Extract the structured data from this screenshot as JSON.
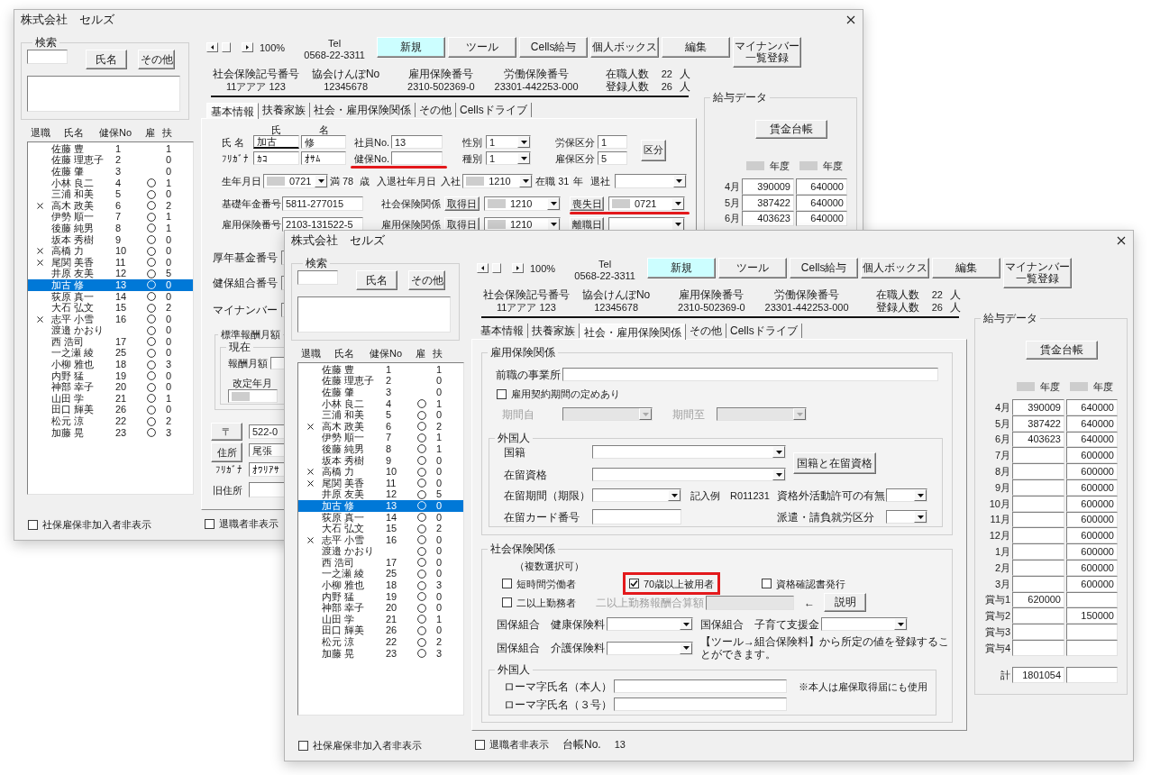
{
  "windows": [
    {
      "title": "株式会社　セルズ",
      "search": {
        "legend": "検索",
        "buttons": [
          "氏名",
          "その他"
        ]
      },
      "list": {
        "columns": [
          "退職",
          "氏名",
          "健保No",
          "雇",
          "扶"
        ],
        "rows": [
          {
            "retired": false,
            "name": "佐藤 豊",
            "no": "1",
            "employment_insured": false,
            "dependents": "1",
            "selected": false
          },
          {
            "retired": false,
            "name": "佐藤 理恵子",
            "no": "2",
            "employment_insured": false,
            "dependents": "0",
            "selected": false
          },
          {
            "retired": false,
            "name": "佐藤 肇",
            "no": "3",
            "employment_insured": false,
            "dependents": "0",
            "selected": false
          },
          {
            "retired": false,
            "name": "小林 良二",
            "no": "4",
            "employment_insured": true,
            "dependents": "1",
            "selected": false
          },
          {
            "retired": false,
            "name": "三浦 和美",
            "no": "5",
            "employment_insured": true,
            "dependents": "0",
            "selected": false
          },
          {
            "retired": true,
            "name": "高木 政美",
            "no": "6",
            "employment_insured": true,
            "dependents": "2",
            "selected": false
          },
          {
            "retired": false,
            "name": "伊勢 順一",
            "no": "7",
            "employment_insured": true,
            "dependents": "1",
            "selected": false
          },
          {
            "retired": false,
            "name": "後藤 純男",
            "no": "8",
            "employment_insured": true,
            "dependents": "1",
            "selected": false
          },
          {
            "retired": false,
            "name": "坂本 秀樹",
            "no": "9",
            "employment_insured": true,
            "dependents": "0",
            "selected": false
          },
          {
            "retired": true,
            "name": "高橋 力",
            "no": "10",
            "employment_insured": true,
            "dependents": "0",
            "selected": false
          },
          {
            "retired": true,
            "name": "尾関 美香",
            "no": "11",
            "employment_insured": true,
            "dependents": "0",
            "selected": false
          },
          {
            "retired": false,
            "name": "井原 友美",
            "no": "12",
            "employment_insured": true,
            "dependents": "5",
            "selected": false
          },
          {
            "retired": false,
            "name": "加古 修",
            "no": "13",
            "employment_insured": true,
            "dependents": "0",
            "selected": true
          },
          {
            "retired": false,
            "name": "荻原 真一",
            "no": "14",
            "employment_insured": true,
            "dependents": "0",
            "selected": false
          },
          {
            "retired": false,
            "name": "大石 弘文",
            "no": "15",
            "employment_insured": true,
            "dependents": "2",
            "selected": false
          },
          {
            "retired": true,
            "name": "志平 小雪",
            "no": "16",
            "employment_insured": true,
            "dependents": "0",
            "selected": false
          },
          {
            "retired": false,
            "name": "渡邉 かおり",
            "employment_insured": true,
            "dependents": "0",
            "selected": false
          },
          {
            "retired": false,
            "name": "西 浩司",
            "no": "17",
            "employment_insured": true,
            "dependents": "0",
            "selected": false
          },
          {
            "retired": false,
            "name": "一之瀬 綾",
            "no": "25",
            "employment_insured": true,
            "dependents": "0",
            "selected": false
          },
          {
            "retired": false,
            "name": "小柳 雅也",
            "no": "18",
            "employment_insured": true,
            "dependents": "3",
            "selected": false
          },
          {
            "retired": false,
            "name": "内野 猛",
            "no": "19",
            "employment_insured": true,
            "dependents": "0",
            "selected": false
          },
          {
            "retired": false,
            "name": "神部 幸子",
            "no": "20",
            "employment_insured": true,
            "dependents": "0",
            "selected": false
          },
          {
            "retired": false,
            "name": "山田 学",
            "no": "21",
            "employment_insured": true,
            "dependents": "1",
            "selected": false
          },
          {
            "retired": false,
            "name": "田口 輝美",
            "no": "26",
            "employment_insured": true,
            "dependents": "0",
            "selected": false
          },
          {
            "retired": false,
            "name": "松元 涼",
            "no": "22",
            "employment_insured": true,
            "dependents": "2",
            "selected": false
          },
          {
            "retired": false,
            "name": "加藤 晃",
            "no": "23",
            "employment_insured": true,
            "dependents": "3",
            "selected": false
          }
        ]
      },
      "hide_uninsured": {
        "label": "社保雇保非加入者非表示",
        "checked": false
      },
      "toolbar": {
        "zoom": "100%",
        "tel_label": "Tel",
        "tel": "0568-22-3311",
        "buttons": [
          {
            "label": "新規",
            "active": true
          },
          {
            "label": "ツール",
            "active": false
          },
          {
            "label": "Cells給与",
            "active": false
          },
          {
            "label": "個人ボックス",
            "active": false
          },
          {
            "label": "編集",
            "active": false
          },
          {
            "label": "マイナンバー一覧登録",
            "active": false
          }
        ]
      },
      "summary": [
        {
          "label": "社会保険記号番号",
          "value": "11アアア 123"
        },
        {
          "label": "協会けんぽNo",
          "value": "12345678"
        },
        {
          "label": "雇用保険番号",
          "value": "2310-502369-0"
        },
        {
          "label": "労働保険番号",
          "value": "23301-442253-000"
        }
      ],
      "headcount": [
        {
          "label": "在職人数",
          "value": "22",
          "unit": "人"
        },
        {
          "label": "登録人数",
          "value": "26",
          "unit": "人"
        }
      ],
      "tabs": [
        {
          "label": "基本情報",
          "selected": true
        },
        {
          "label": "扶養家族",
          "selected": false
        },
        {
          "label": "社会・雇用保険関係",
          "selected": false
        },
        {
          "label": "その他",
          "selected": false
        },
        {
          "label": "Cellsドライブ",
          "selected": false
        }
      ],
      "basic_info": {
        "name_headers": [
          "氏",
          "名"
        ],
        "name": {
          "label": "氏 名",
          "family": "加古",
          "given": "修",
          "focused": true
        },
        "kana": {
          "label": "ﾌﾘｶﾞﾅ",
          "family": "ｶｺ",
          "given": "ｵｻﾑ"
        },
        "employee_no": {
          "label": "社員No.",
          "value": "13"
        },
        "health_no": {
          "label": "健保No.",
          "marked": true
        },
        "gender": {
          "label": "性別",
          "value": "1"
        },
        "category": {
          "label": "種別",
          "value": "1"
        },
        "labor_class": {
          "label": "労保区分",
          "value": "1"
        },
        "employment_class": {
          "label": "雇保区分",
          "value": "5"
        },
        "class_button": "区分",
        "birth": {
          "label": "生年月日",
          "value": "0721",
          "masked": true
        },
        "age": {
          "prefix": "満",
          "value": "78",
          "unit": "歳"
        },
        "hire_label": "入退社年月日",
        "hire": {
          "label": "入社",
          "value": "1210",
          "masked": true
        },
        "tenure": {
          "label": "在職",
          "value": "31",
          "unit": "年"
        },
        "retire": {
          "label": "退社"
        },
        "pension_no": {
          "label": "基礎年金番号",
          "value": "5811-277015"
        },
        "social": {
          "label": "社会保険関係",
          "acquire_button": "取得日",
          "acquire": {
            "value": "1210",
            "masked": true
          },
          "loss_button": "喪失日",
          "loss": {
            "value": "0721",
            "masked": true,
            "marked": true
          }
        },
        "employment_ins_no": {
          "label": "雇用保険番号",
          "value": "2103-131522-5"
        },
        "employment": {
          "label": "雇用保険関係",
          "acquire_button": "取得日",
          "acquire": {
            "value": "1210",
            "masked": true
          },
          "leave_button": "離職日"
        },
        "fund_no": {
          "label": "厚年基金番号"
        },
        "union_no": {
          "label": "健保組合番号"
        },
        "my_number": {
          "label": "マイナンバー"
        },
        "standard_pay": {
          "legend": "標準報酬月額",
          "current": {
            "legend": "現在",
            "pay_label": "報酬月額",
            "revised_label": "改定年月",
            "revised_masked": true
          }
        },
        "postal": {
          "button": "〒",
          "value": "522-0"
        },
        "address": {
          "button": "住所",
          "value": "尾張",
          "kana_label": "ﾌﾘｶﾞﾅ",
          "kana": "ｵﾜﾘｱｻ"
        },
        "old_address": {
          "label": "旧住所"
        }
      },
      "salary": {
        "legend": "給与データ",
        "ledger_button": "賃金台帳",
        "years": [
          {
            "text": "年度",
            "masked": true
          },
          {
            "text": "年度",
            "masked": true
          }
        ],
        "rows": [
          {
            "label": "4月",
            "col_1": "390009",
            "col_2": "640000"
          },
          {
            "label": "5月",
            "col_1": "387422",
            "col_2": "640000"
          },
          {
            "label": "6月",
            "col_1": "403623",
            "col_2": "640000"
          }
        ]
      },
      "hide_retired": {
        "label": "退職者非表示",
        "checked": false
      }
    },
    {
      "title": "株式会社　セルズ",
      "search": {
        "legend": "検索",
        "buttons": [
          "氏名",
          "その他"
        ]
      },
      "list": {
        "columns": [
          "退職",
          "氏名",
          "健保No",
          "雇",
          "扶"
        ],
        "rows": [
          {
            "retired": false,
            "name": "佐藤 豊",
            "no": "1",
            "employment_insured": false,
            "dependents": "1",
            "selected": false
          },
          {
            "retired": false,
            "name": "佐藤 理恵子",
            "no": "2",
            "employment_insured": false,
            "dependents": "0",
            "selected": false
          },
          {
            "retired": false,
            "name": "佐藤 肇",
            "no": "3",
            "employment_insured": false,
            "dependents": "0",
            "selected": false
          },
          {
            "retired": false,
            "name": "小林 良二",
            "no": "4",
            "employment_insured": true,
            "dependents": "1",
            "selected": false
          },
          {
            "retired": false,
            "name": "三浦 和美",
            "no": "5",
            "employment_insured": true,
            "dependents": "0",
            "selected": false
          },
          {
            "retired": true,
            "name": "高木 政美",
            "no": "6",
            "employment_insured": true,
            "dependents": "2",
            "selected": false
          },
          {
            "retired": false,
            "name": "伊勢 順一",
            "no": "7",
            "employment_insured": true,
            "dependents": "1",
            "selected": false
          },
          {
            "retired": false,
            "name": "後藤 純男",
            "no": "8",
            "employment_insured": true,
            "dependents": "1",
            "selected": false
          },
          {
            "retired": false,
            "name": "坂本 秀樹",
            "no": "9",
            "employment_insured": true,
            "dependents": "0",
            "selected": false
          },
          {
            "retired": true,
            "name": "高橋 力",
            "no": "10",
            "employment_insured": true,
            "dependents": "0",
            "selected": false
          },
          {
            "retired": true,
            "name": "尾関 美香",
            "no": "11",
            "employment_insured": true,
            "dependents": "0",
            "selected": false
          },
          {
            "retired": false,
            "name": "井原 友美",
            "no": "12",
            "employment_insured": true,
            "dependents": "5",
            "selected": false
          },
          {
            "retired": false,
            "name": "加古 修",
            "no": "13",
            "employment_insured": true,
            "dependents": "0",
            "selected": true
          },
          {
            "retired": false,
            "name": "荻原 真一",
            "no": "14",
            "employment_insured": true,
            "dependents": "0",
            "selected": false
          },
          {
            "retired": false,
            "name": "大石 弘文",
            "no": "15",
            "employment_insured": true,
            "dependents": "2",
            "selected": false
          },
          {
            "retired": true,
            "name": "志平 小雪",
            "no": "16",
            "employment_insured": true,
            "dependents": "0",
            "selected": false
          },
          {
            "retired": false,
            "name": "渡邉 かおり",
            "employment_insured": true,
            "dependents": "0",
            "selected": false
          },
          {
            "retired": false,
            "name": "西 浩司",
            "no": "17",
            "employment_insured": true,
            "dependents": "0",
            "selected": false
          },
          {
            "retired": false,
            "name": "一之瀬 綾",
            "no": "25",
            "employment_insured": true,
            "dependents": "0",
            "selected": false
          },
          {
            "retired": false,
            "name": "小柳 雅也",
            "no": "18",
            "employment_insured": true,
            "dependents": "3",
            "selected": false
          },
          {
            "retired": false,
            "name": "内野 猛",
            "no": "19",
            "employment_insured": true,
            "dependents": "0",
            "selected": false
          },
          {
            "retired": false,
            "name": "神部 幸子",
            "no": "20",
            "employment_insured": true,
            "dependents": "0",
            "selected": false
          },
          {
            "retired": false,
            "name": "山田 学",
            "no": "21",
            "employment_insured": true,
            "dependents": "1",
            "selected": false
          },
          {
            "retired": false,
            "name": "田口 輝美",
            "no": "26",
            "employment_insured": true,
            "dependents": "0",
            "selected": false
          },
          {
            "retired": false,
            "name": "松元 涼",
            "no": "22",
            "employment_insured": true,
            "dependents": "2",
            "selected": false
          },
          {
            "retired": false,
            "name": "加藤 晃",
            "no": "23",
            "employment_insured": true,
            "dependents": "3",
            "selected": false
          }
        ]
      },
      "hide_uninsured": {
        "label": "社保雇保非加入者非表示",
        "checked": false
      },
      "toolbar": {
        "zoom": "100%",
        "tel_label": "Tel",
        "tel": "0568-22-3311",
        "buttons": [
          {
            "label": "新規",
            "active": true
          },
          {
            "label": "ツール",
            "active": false
          },
          {
            "label": "Cells給与",
            "active": false
          },
          {
            "label": "個人ボックス",
            "active": false
          },
          {
            "label": "編集",
            "active": false
          },
          {
            "label": "マイナンバー一覧登録",
            "active": false
          }
        ]
      },
      "summary": [
        {
          "label": "社会保険記号番号",
          "value": "11アアア 123"
        },
        {
          "label": "協会けんぽNo",
          "value": "12345678"
        },
        {
          "label": "雇用保険番号",
          "value": "2310-502369-0"
        },
        {
          "label": "労働保険番号",
          "value": "23301-442253-000"
        }
      ],
      "headcount": [
        {
          "label": "在職人数",
          "value": "22",
          "unit": "人"
        },
        {
          "label": "登録人数",
          "value": "26",
          "unit": "人"
        }
      ],
      "tabs": [
        {
          "label": "基本情報",
          "selected": false
        },
        {
          "label": "扶養家族",
          "selected": false
        },
        {
          "label": "社会・雇用保険関係",
          "selected": true
        },
        {
          "label": "その他",
          "selected": false
        },
        {
          "label": "Cellsドライブ",
          "selected": false
        }
      ],
      "insurance": {
        "employment": {
          "legend": "雇用保険関係",
          "previous_employer": {
            "label": "前職の事業所"
          },
          "fixed_term": {
            "label": "雇用契約期間の定めあり",
            "checked": false
          },
          "period_from": {
            "label": "期間自",
            "disabled": true
          },
          "period_to": {
            "label": "期間至",
            "disabled": true
          },
          "foreign": {
            "legend": "外国人",
            "nationality": {
              "label": "国籍"
            },
            "residence_status": {
              "label": "在留資格"
            },
            "lookup_button": "国籍と在留資格",
            "residence_period": {
              "label": "在留期間（期限）"
            },
            "example": "記入例　R011231",
            "work_permit": {
              "label": "資格外活動許可の有無"
            },
            "card_no": {
              "label": "在留カード番号"
            },
            "dispatch": {
              "label": "派遣・請負就労区分"
            }
          }
        },
        "social": {
          "legend": "社会保険関係",
          "note": "（複数選択可）",
          "checks": [
            {
              "label": "短時間労働者",
              "checked": false,
              "marked": false
            },
            {
              "label": "70歳以上被用者",
              "checked": true,
              "marked": true
            },
            {
              "label": "資格確認書発行",
              "checked": false,
              "marked": false
            },
            {
              "label": "二以上勤務者",
              "checked": false,
              "marked": false
            }
          ],
          "combined_pay": {
            "label": "二以上勤務報酬合算額",
            "disabled": true
          },
          "arrow": "←",
          "explain_button": "説明",
          "health_premium": {
            "label": "国保組合　健康保険料"
          },
          "childcare": {
            "label": "国保組合　子育て支援金"
          },
          "care_premium": {
            "label": "国保組合　介護保険料"
          },
          "premium_note": "【ツール→組合保険料】から所定の値を登録することができます。",
          "foreign": {
            "legend": "外国人",
            "roman_self": {
              "label": "ローマ字氏名（本人）"
            },
            "self_note": "※本人は雇保取得届にも使用",
            "roman_dependent": {
              "label": "ローマ字氏名（３号）"
            }
          }
        }
      },
      "salary": {
        "legend": "給与データ",
        "ledger_button": "賃金台帳",
        "years": [
          {
            "text": "年度",
            "masked": true
          },
          {
            "text": "年度",
            "masked": true
          }
        ],
        "rows": [
          {
            "label": "4月",
            "col_1": "390009",
            "col_2": "640000"
          },
          {
            "label": "5月",
            "col_1": "387422",
            "col_2": "640000"
          },
          {
            "label": "6月",
            "col_1": "403623",
            "col_2": "640000"
          },
          {
            "label": "7月",
            "col_2": "600000"
          },
          {
            "label": "8月",
            "col_2": "600000"
          },
          {
            "label": "9月",
            "col_2": "600000"
          },
          {
            "label": "10月",
            "col_2": "600000"
          },
          {
            "label": "11月",
            "col_2": "600000"
          },
          {
            "label": "12月",
            "col_2": "600000"
          },
          {
            "label": "1月",
            "col_2": "600000"
          },
          {
            "label": "2月",
            "col_2": "600000"
          },
          {
            "label": "3月",
            "col_2": "600000"
          },
          {
            "label": "賞与1",
            "col_1": "620000"
          },
          {
            "label": "賞与2",
            "col_2": "150000"
          },
          {
            "label": "賞与3"
          },
          {
            "label": "賞与4"
          }
        ],
        "total": {
          "label": "計",
          "col_1": "1801054"
        }
      },
      "hide_retired": {
        "label": "退職者非表示",
        "checked": false
      },
      "ledger_no": {
        "label": "台帳No.",
        "value": "13"
      }
    }
  ]
}
